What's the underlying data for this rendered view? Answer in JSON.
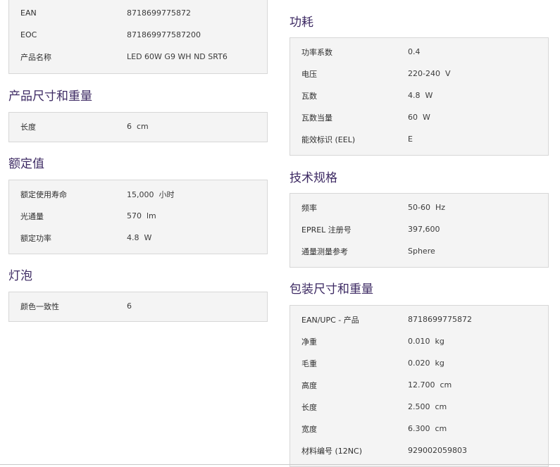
{
  "left": {
    "top_panel": [
      {
        "label": "EAN",
        "value": "8718699775872"
      },
      {
        "label": "EOC",
        "value": "871869977587200"
      },
      {
        "label": "产品名称",
        "value": "LED 60W G9 WH ND SRT6"
      }
    ],
    "size_weight": {
      "title": "产品尺寸和重量",
      "rows": [
        {
          "label": "长度",
          "value": "6  cm"
        }
      ]
    },
    "ratings": {
      "title": "额定值",
      "rows": [
        {
          "label": "额定使用寿命",
          "value": "15,000  小时"
        },
        {
          "label": "光通量",
          "value": "570  lm"
        },
        {
          "label": "额定功率",
          "value": "4.8  W"
        }
      ]
    },
    "bulb": {
      "title": "灯泡",
      "rows": [
        {
          "label": "颜色一致性",
          "value": "6"
        }
      ]
    }
  },
  "right": {
    "power": {
      "title": "功耗",
      "rows": [
        {
          "label": "功率系数",
          "value": "0.4"
        },
        {
          "label": "电压",
          "value": "220-240  V"
        },
        {
          "label": "瓦数",
          "value": "4.8  W"
        },
        {
          "label": "瓦数当量",
          "value": "60  W"
        },
        {
          "label": "能效标识 (EEL)",
          "value": "E"
        }
      ]
    },
    "tech": {
      "title": "技术规格",
      "rows": [
        {
          "label": "频率",
          "value": "50-60  Hz"
        },
        {
          "label": "EPREL 注册号",
          "value": "397,600"
        },
        {
          "label": "通量测量参考",
          "value": "Sphere"
        }
      ]
    },
    "packaging": {
      "title": "包装尺寸和重量",
      "rows": [
        {
          "label": "EAN/UPC - 产品",
          "value": "8718699775872"
        },
        {
          "label": "净重",
          "value": "0.010  kg"
        },
        {
          "label": "毛重",
          "value": "0.020  kg"
        },
        {
          "label": "高度",
          "value": "12.700  cm"
        },
        {
          "label": "长度",
          "value": "2.500  cm"
        },
        {
          "label": "宽度",
          "value": "6.300  cm"
        },
        {
          "label": "材料编号 (12NC)",
          "value": "929002059803"
        }
      ]
    }
  }
}
